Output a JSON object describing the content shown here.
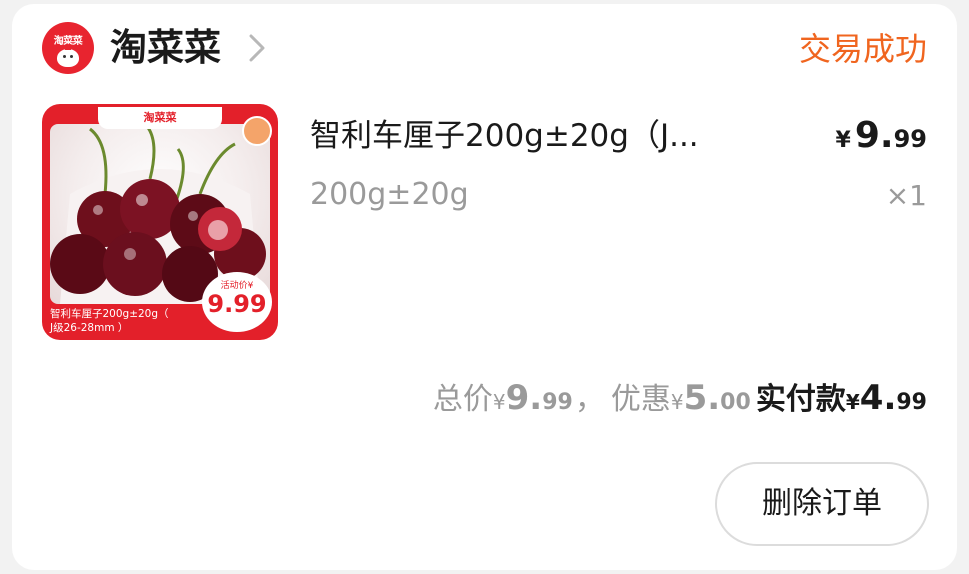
{
  "shop": {
    "logo_text": "淘菜菜",
    "name": "淘菜菜"
  },
  "order": {
    "status": "交易成功"
  },
  "product": {
    "image": {
      "brand_text": "淘菜菜",
      "caption_line1": "智利车厘子200g±20g（",
      "caption_line2": "J级26-28mm ）",
      "badge_label": "活动价¥",
      "badge_price": "9.99"
    },
    "title": "智利车厘子200g±20g（J...",
    "spec": "200g±20g",
    "price": {
      "currency": "¥",
      "integer": "9.",
      "decimal": "99"
    },
    "quantity": "×1"
  },
  "summary": {
    "total_label": "总价",
    "total_currency": "¥",
    "total_integer": "9.",
    "total_decimal": "99",
    "separator": "，",
    "discount_label": "优惠",
    "discount_currency": "¥",
    "discount_integer": "5.",
    "discount_decimal": "00",
    "paid_label": "实付款",
    "paid_currency": "¥",
    "paid_integer": "4.",
    "paid_decimal": "99"
  },
  "actions": {
    "delete_label": "删除订单"
  },
  "colors": {
    "status_orange": "#f0651f",
    "brand_red": "#e3202a",
    "muted_gray": "#9a9a9a"
  }
}
